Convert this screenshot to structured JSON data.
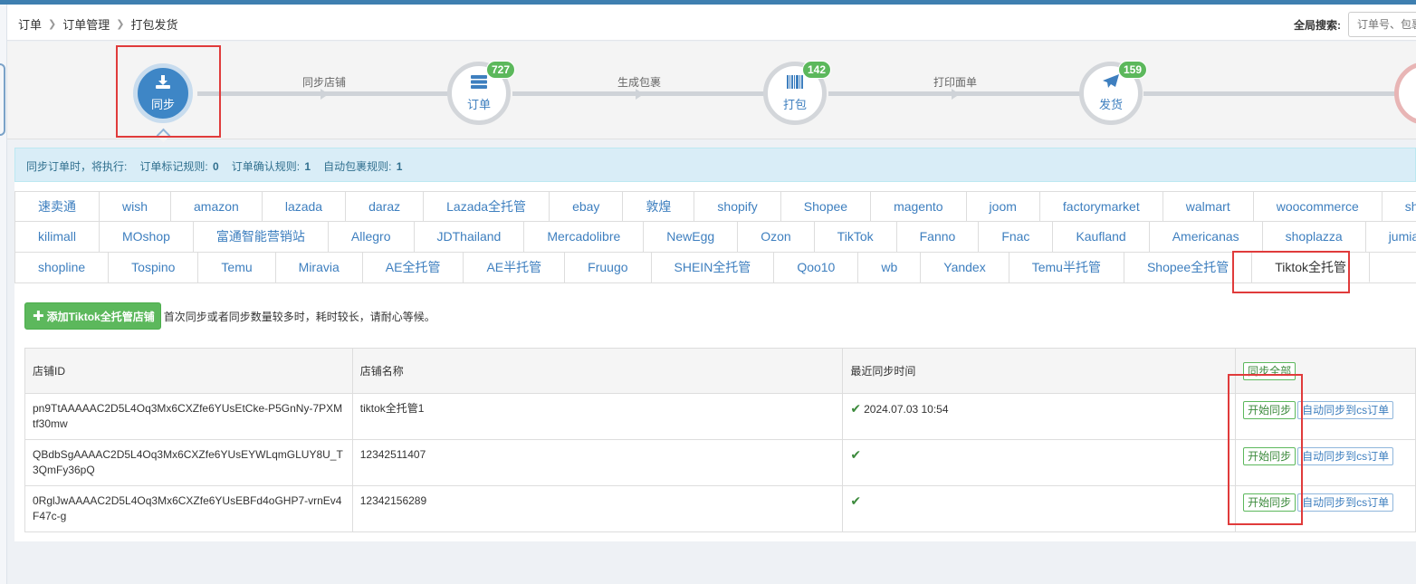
{
  "breadcrumb": [
    "订单",
    "订单管理",
    "打包发货"
  ],
  "global_search": {
    "label": "全局搜索:",
    "placeholder": "订单号、包裹"
  },
  "steps": [
    {
      "label": "同步",
      "icon": "download-icon",
      "badge": null,
      "active": true
    },
    {
      "label": "订单",
      "icon": "server-icon",
      "badge": "727"
    },
    {
      "label": "打包",
      "icon": "barcode-icon",
      "badge": "142"
    },
    {
      "label": "发货",
      "icon": "paper-plane-icon",
      "badge": "159"
    }
  ],
  "step_links": [
    "同步店铺",
    "生成包裹",
    "打印面单"
  ],
  "alert": {
    "prefix": "同步订单时，将执行:",
    "rules": [
      {
        "label": "订单标记规则:",
        "value": "0"
      },
      {
        "label": "订单确认规则:",
        "value": "1"
      },
      {
        "label": "自动包裹规则:",
        "value": "1"
      }
    ]
  },
  "platform_tabs": [
    [
      "速卖通",
      "wish",
      "amazon",
      "lazada",
      "daraz",
      "Lazada全托管",
      "ebay",
      "敦煌",
      "shopify",
      "Shopee",
      "magento",
      "joom",
      "factorymarket",
      "walmart",
      "woocommerce",
      "shopyy"
    ],
    [
      "kilimall",
      "MOshop",
      "富通智能营销站",
      "Allegro",
      "JDThailand",
      "Mercadolibre",
      "NewEgg",
      "Ozon",
      "TikTok",
      "Fanno",
      "Fnac",
      "Kaufland",
      "Americanas",
      "shoplazza",
      "jumia"
    ],
    [
      "shopline",
      "Tospino",
      "Temu",
      "Miravia",
      "AE全托管",
      "AE半托管",
      "Fruugo",
      "SHEIN全托管",
      "Qoo10",
      "wb",
      "Yandex",
      "Temu半托管",
      "Shopee全托管",
      "Tiktok全托管"
    ]
  ],
  "active_tab": "Tiktok全托管",
  "toolbar": {
    "add_button": "添加Tiktok全托管店铺",
    "hint": "首次同步或者同步数量较多时，耗时较长，请耐心等候。"
  },
  "table": {
    "headers": [
      "店铺ID",
      "店铺名称",
      "最近同步时间"
    ],
    "sync_all": "同步全部",
    "rows": [
      {
        "id": "pn9TtAAAAAC2D5L4Oq3Mx6CXZfe6YUsEtCke-P5GnNy-7PXMtf30mw",
        "name": "tiktok全托管1",
        "time": "2024.07.03 10:54"
      },
      {
        "id": "QBdbSgAAAAC2D5L4Oq3Mx6CXZfe6YUsEYWLqmGLUY8U_T3QmFy36pQ",
        "name": "12342511407",
        "time": ""
      },
      {
        "id": "0RglJwAAAAC2D5L4Oq3Mx6CXZfe6YUsEBFd4oGHP7-vrnEv4F47c-g",
        "name": "12342156289",
        "time": ""
      }
    ],
    "start_sync": "开始同步",
    "auto_sync": "自动同步到cs订单"
  }
}
